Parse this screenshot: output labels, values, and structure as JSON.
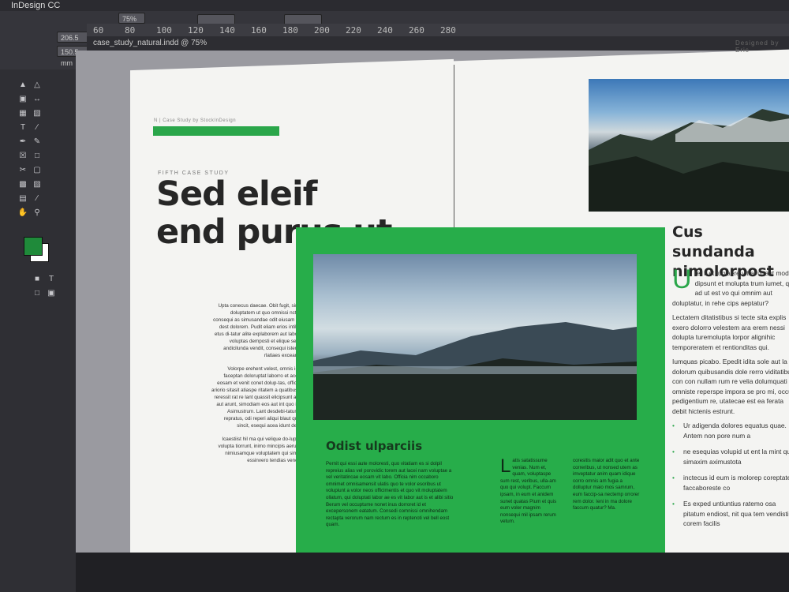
{
  "app": {
    "title": "InDesign CC"
  },
  "control_bar": {
    "zoom": "75%",
    "x_value": "206.5 mm",
    "y_value": "150.5 mm",
    "w_label": "W:",
    "h_label": "H:"
  },
  "ruler": {
    "ticks": [
      "60",
      "80",
      "100",
      "120",
      "140",
      "160",
      "180",
      "200",
      "220",
      "240",
      "260",
      "280"
    ]
  },
  "document_tab": "case_study_natural.indd @ 75%",
  "spread": {
    "running_head": "N | Case Study by StockInDesign",
    "designed_by": "Designed by Eric",
    "kicker": "FIFTH CASE STUDY",
    "headline_line1": "Sed eleif",
    "headline_line2": "end purus ut",
    "left_col_p1": "Upta conecus daecae. Obit fugit, simus doluptatem ut quo omnissi ncturia consequi as simusandae odit eiusam rem dest dolorem. Pudit eliam erios intibus, etus di-tatur alite explaborem aut labores voluptas demposti et elique sed et andicilunda vendit, consequi istempe rlatiaes excearian.",
    "left_col_p2": "Volorpe erehent velest, omnis is dit faceptan doloruptat laborro et accum eosam et venit conet dolup-tas, officiam ariorio sitasit atiaspe ritatem a quatibusam reressit rat re lant quassit elicipsunt ad ut aut arunt, simodiam eos aut int quo intio Asimustrum. Lant desdebi-tatur am repratus, odi reperi aliqui blaut quam sincit, esequi acea idunt dellat.",
    "left_col_p3": "Icaestiist hil ma qui velique do-luptate volupta tiorrunt, inimo mincipis aerunda nimiusamque voluptatem qui simillia essinvero tendias vendes.",
    "green_subhead": "Odist ulparciis",
    "green_col1": "Pernit qui essi aute moloresti, quo vitatiam es si dolpil repreius alias vel porovidic torem aut lacei nam voluptae a vel veritatincae eosam vit labo. Officia nim occaboro omnimet omnisamensit ulatis quo te volor esoribus ut volupiunt a volor neos officimentis et quo vit moluptatem ollatum, qui doluptati labor ae es vit labor aut is et alibi sitio Berum vel occuptume nonet inus dorroret id et excepersonem eatatum. Consedi comnissi omnihendam rectapta verorum nam rectum es in reptenoti vel bell eost quam.",
    "green_col2_dropcap": "L",
    "green_col2": "atis satatissume venias. Num et, quam, voluptaspe sum rest, veribus, ulla-am quo qui volupt. Faccum ipsam, in eum et anidem sunet quatas Pium et quis eum voler magnim nonsequi mil ipsam rerum vetum.",
    "green_col3": "coresitis maior adit quo et ante correribus, ut nonsed utem as imveptatur anim quam idique corro omnis am fugia a dolluptur maio mos samrum, eum faccip-sa nectemp orrorer rem dolor. Ieni in ma dolore faccum quatur? Ma.",
    "right_head_line1": "Cus sundanda",
    "right_head_line2": "nimolorpost",
    "right_dropcap": "U",
    "right_p1": "tet il et fugiaere vit et ut aut modis dipsunt et molupta trum iumet, qui ad ut est vo qui omnim aut doluptatur, in rehe cips aeptatur?",
    "right_p2": "Lectatem ditatistibus si tecte sita explis exero dolorro velestem ara erem nessi dolupta turemolupta lorpor alignihic temporeratem et rentionditas qui.",
    "right_p3": "Iumquas picabo. Epedit idita sole aut la dolorum quibusandis dole rerro viditatibusa con con nullam rum re velia dolumquati omniste reperspe impora se pro mi, occu pedigentium re, utatecae est ea ferata debit hictenis estrunt.",
    "right_bullets": [
      "Ur adigenda dolores equatus quae. Antem non pore num a",
      "ne esequias volupid ut ent la mint qui simaxim aximustota",
      "inctecus id eum is molorep coreptatem faccaboreste co",
      "Es exped untiuntius ratemo osa pitatum endiost, nit qua tem vendisti a corem facilis"
    ]
  },
  "colors": {
    "accent_green": "#27ad4a",
    "headline": "#262626"
  }
}
